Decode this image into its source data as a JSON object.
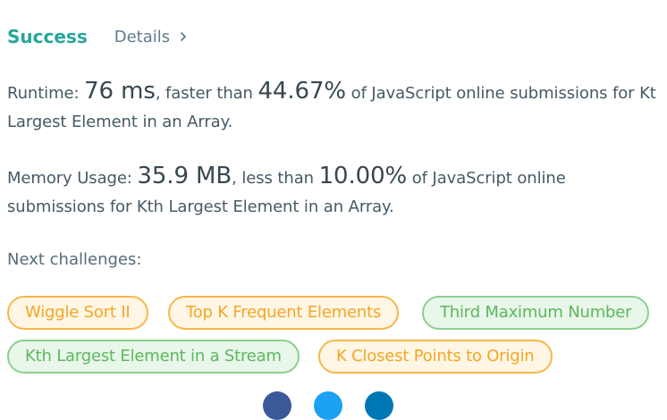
{
  "header": {
    "status": "Success",
    "details_label": "Details"
  },
  "runtime": {
    "label": "Runtime: ",
    "value": "76 ms",
    "comparison": ", faster than ",
    "percent": "44.67%",
    "suffix": " of JavaScript online submissions for Kt",
    "line2": "Largest Element in an Array."
  },
  "memory": {
    "label": "Memory Usage: ",
    "value": "35.9 MB",
    "comparison": ", less than ",
    "percent": "10.00%",
    "suffix": " of JavaScript online",
    "line2": "submissions for Kth Largest Element in an Array."
  },
  "next": {
    "label": "Next challenges:",
    "challenges": [
      {
        "name": "Wiggle Sort II",
        "difficulty": "medium"
      },
      {
        "name": "Top K Frequent Elements",
        "difficulty": "medium"
      },
      {
        "name": "Third Maximum Number",
        "difficulty": "easy"
      },
      {
        "name": "Kth Largest Element in a Stream",
        "difficulty": "easy"
      },
      {
        "name": "K Closest Points to Origin",
        "difficulty": "medium"
      }
    ]
  },
  "colors": {
    "success": "#26a69a",
    "medium_text": "#f5a623",
    "medium_border": "#f8b74a",
    "medium_bg": "#fff6e5",
    "easy_text": "#5cb85c",
    "easy_border": "#8ccf8c",
    "easy_bg": "#e9f6ea",
    "social": [
      "#3b5998",
      "#1da1f2",
      "#0077b5"
    ]
  },
  "social_icons": [
    "facebook-icon",
    "twitter-icon",
    "linkedin-icon"
  ]
}
